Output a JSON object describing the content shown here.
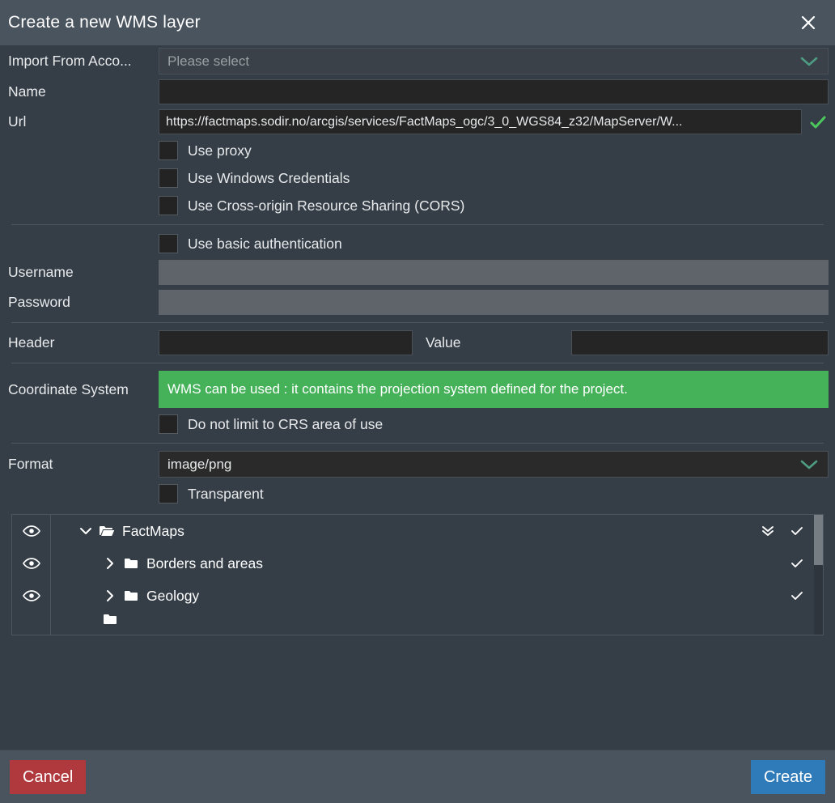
{
  "dialog": {
    "title": "Create a new WMS layer",
    "close_icon": "close-icon"
  },
  "form": {
    "import_from": {
      "label": "Import From Acco...",
      "value": "",
      "placeholder": "Please select",
      "chevron_icon": "chevron-down-icon"
    },
    "name": {
      "label": "Name",
      "value": "",
      "placeholder": ""
    },
    "url": {
      "label": "Url",
      "value": "https://factmaps.sodir.no/arcgis/services/FactMaps_ogc/3_0_WGS84_z32/MapServer/W...",
      "placeholder": "",
      "valid_icon": "check-icon"
    },
    "use_proxy": {
      "label": "Use proxy",
      "checked": false
    },
    "use_windows_credentials": {
      "label": "Use Windows Credentials",
      "checked": false
    },
    "use_cors": {
      "label": "Use Cross-origin Resource Sharing (CORS)",
      "checked": false
    },
    "use_basic_auth": {
      "label": "Use basic authentication",
      "checked": false
    },
    "username": {
      "label": "Username",
      "value": "",
      "disabled": true
    },
    "password": {
      "label": "Password",
      "value": "",
      "disabled": true
    },
    "header": {
      "label": "Header",
      "value": "",
      "placeholder": ""
    },
    "value": {
      "label": "Value",
      "value": "",
      "placeholder": ""
    },
    "coordinate_system": {
      "label": "Coordinate System",
      "message": "WMS can be used : it contains the projection system defined for the project.",
      "message_color": "#45b25a"
    },
    "do_not_limit_crs": {
      "label": "Do not limit to CRS area of use",
      "checked": false
    },
    "format": {
      "label": "Format",
      "value": "image/png",
      "chevron_icon": "chevron-down-icon"
    },
    "transparent": {
      "label": "Transparent",
      "checked": false
    }
  },
  "layer_tree": {
    "rows": [
      {
        "label": "FactMaps",
        "depth": 0,
        "expanded": true,
        "chevron_icon": "chevron-down-icon",
        "folder_icon": "folder-open-icon",
        "eye_icon": "eye-icon",
        "expand_all_icon": "double-chevron-down-icon",
        "check_icon": "check-icon",
        "has_expand_all": true
      },
      {
        "label": "Borders and areas",
        "depth": 1,
        "expanded": false,
        "chevron_icon": "chevron-right-icon",
        "folder_icon": "folder-icon",
        "eye_icon": "eye-icon",
        "check_icon": "check-icon",
        "has_expand_all": false
      },
      {
        "label": "Geology",
        "depth": 1,
        "expanded": false,
        "chevron_icon": "chevron-right-icon",
        "folder_icon": "folder-icon",
        "eye_icon": "eye-icon",
        "check_icon": "check-icon",
        "has_expand_all": false
      }
    ]
  },
  "footer": {
    "cancel_label": "Cancel",
    "create_label": "Create",
    "cancel_color": "#b0393d",
    "create_color": "#2f7ab8"
  }
}
